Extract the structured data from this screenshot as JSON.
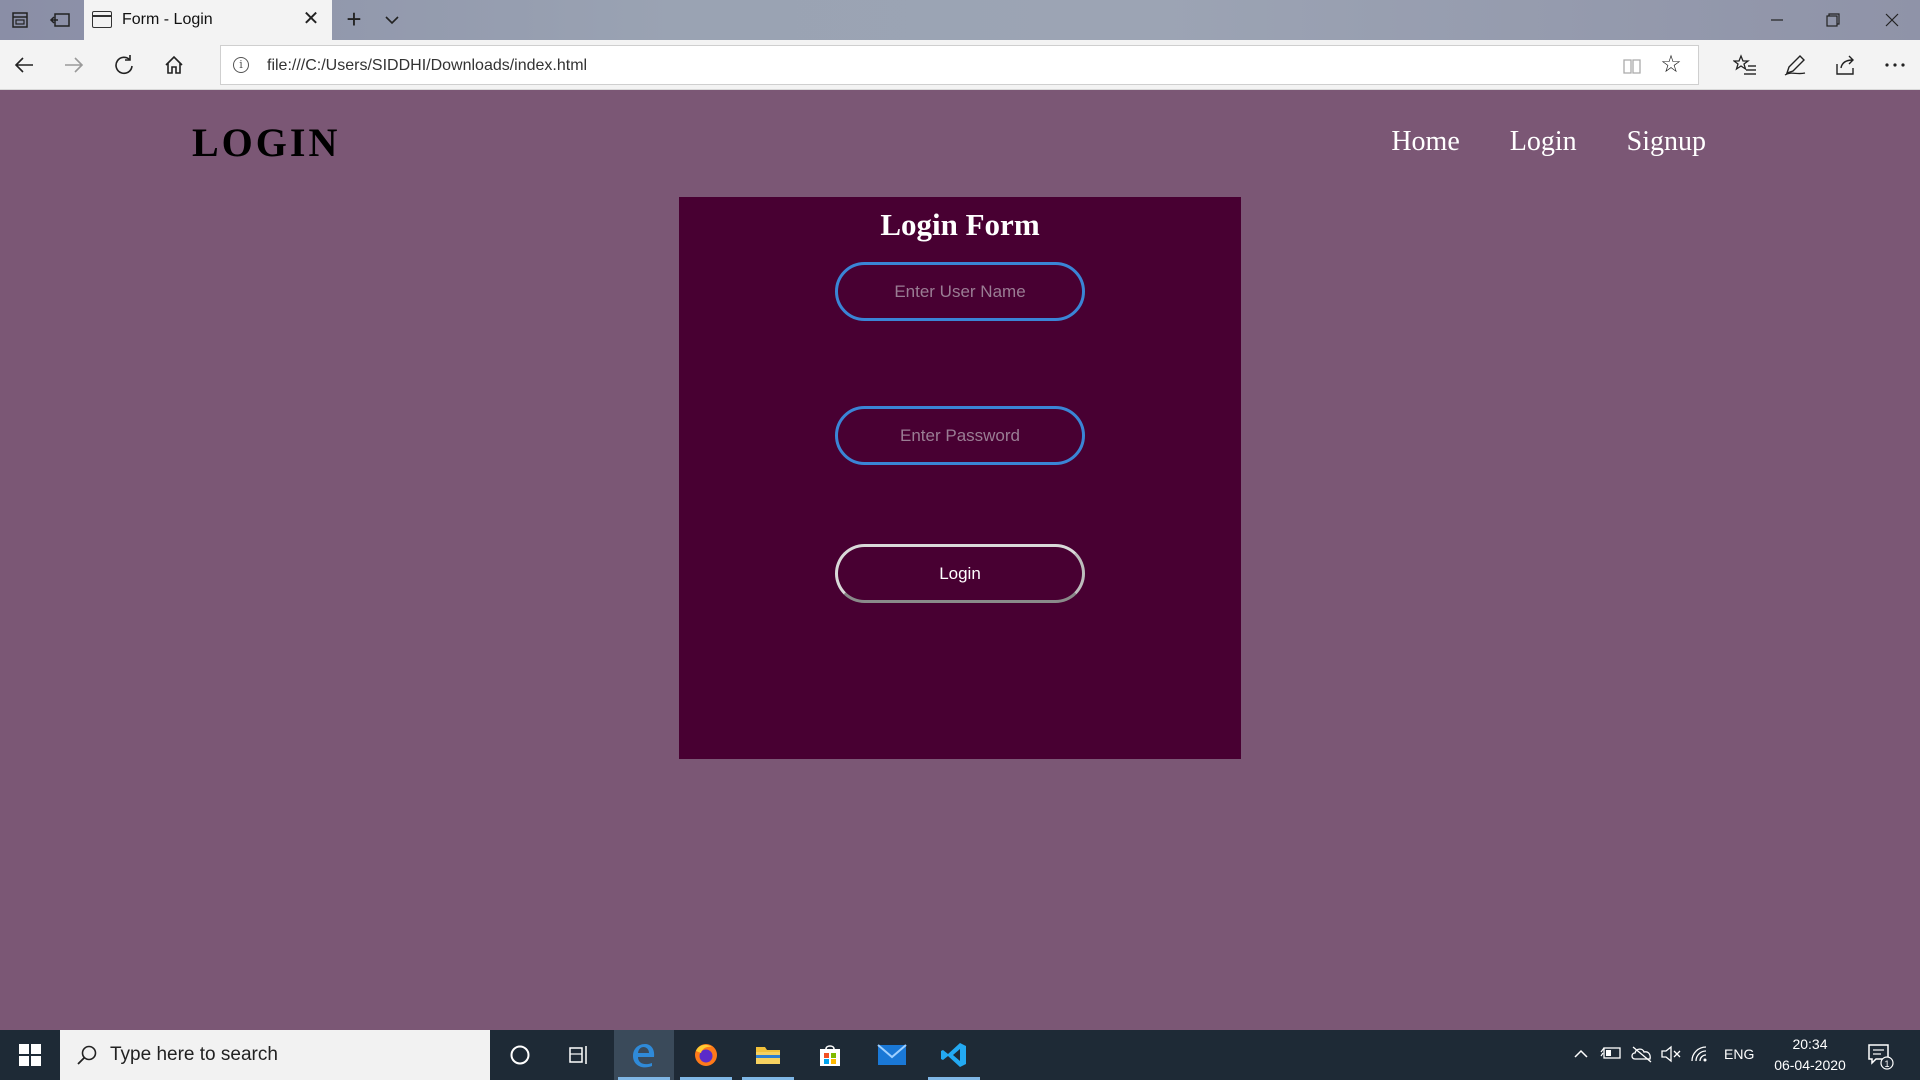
{
  "browser": {
    "tab_title": "Form - Login",
    "url": "file:///C:/Users/SIDDHI/Downloads/index.html"
  },
  "page": {
    "logo": "LOGIN",
    "nav": [
      {
        "label": "Home"
      },
      {
        "label": "Login"
      },
      {
        "label": "Signup"
      }
    ],
    "form": {
      "title": "Login Form",
      "username_placeholder": "Enter User Name",
      "password_placeholder": "Enter Password",
      "submit_label": "Login"
    }
  },
  "taskbar": {
    "search_placeholder": "Type here to search",
    "language": "ENG",
    "time": "20:34",
    "date": "06-04-2020",
    "notification_count": "1"
  },
  "colors": {
    "page_background": "#7b5775",
    "form_background": "#480032",
    "input_border": "#3a85d6"
  }
}
